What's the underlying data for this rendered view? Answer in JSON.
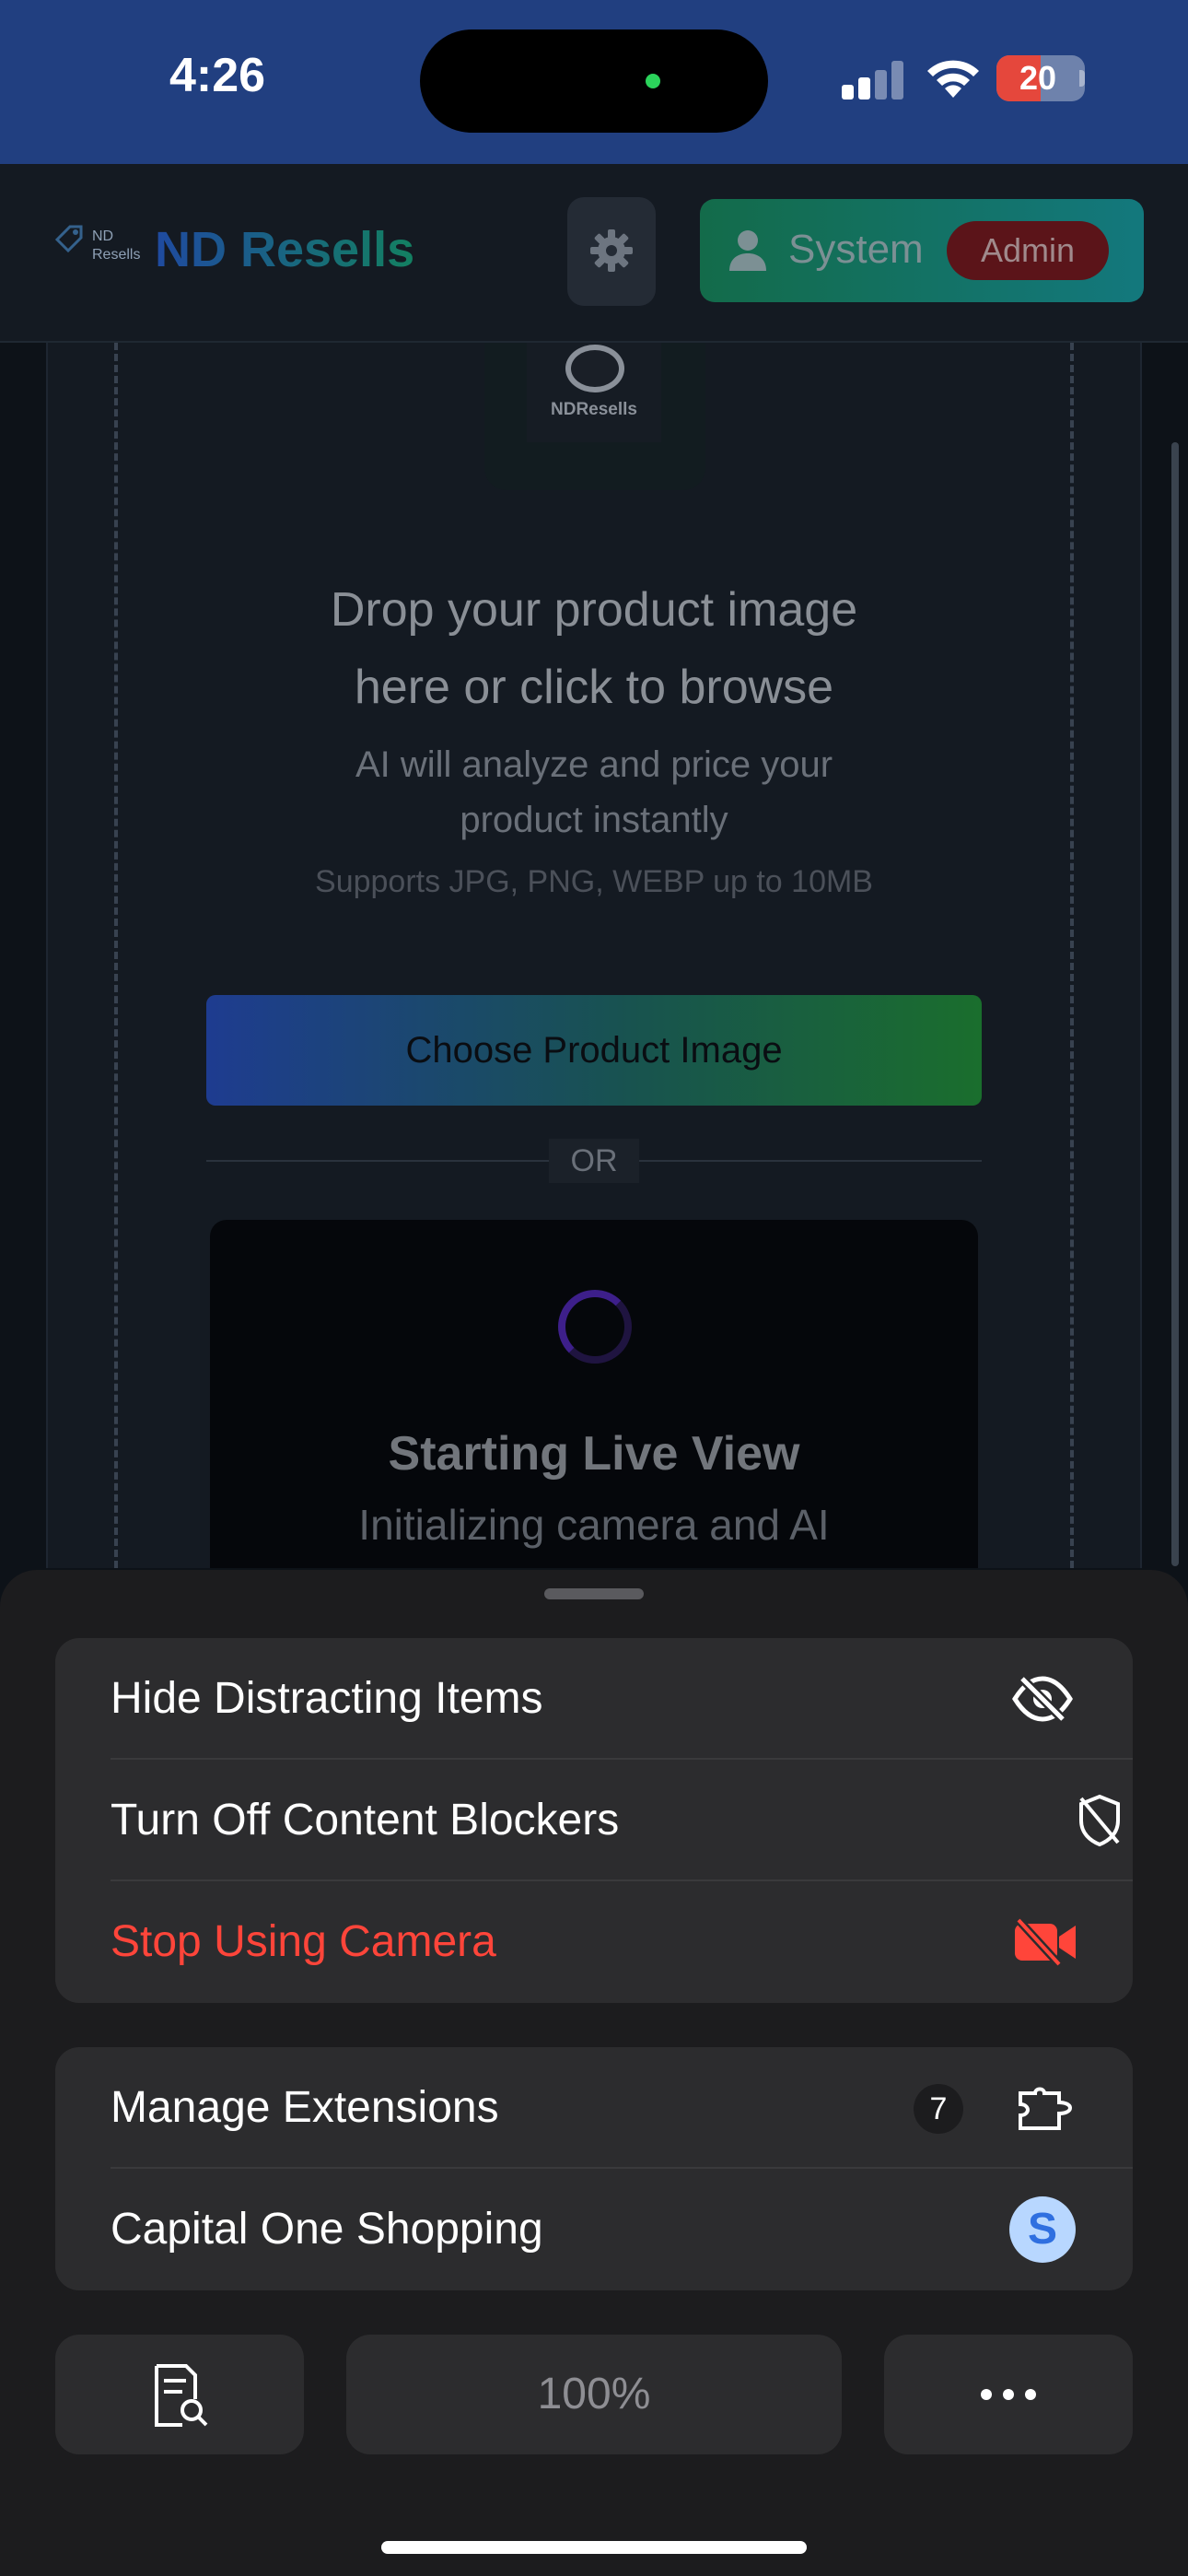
{
  "status_bar": {
    "time": "4:26",
    "battery": "20",
    "battery_color": "#e5473c"
  },
  "header": {
    "logo_text_line1": "ND",
    "logo_text_line2": "Resells",
    "brand": "ND Resells",
    "settings_icon": "gear-icon",
    "user_name": "System",
    "user_role": "Admin"
  },
  "upload": {
    "camera_label": "NDResells",
    "title_line1": "Drop your product image",
    "title_line2": "here or click to browse",
    "subtitle_line1": "AI will analyze and price your",
    "subtitle_line2": "product instantly",
    "formats": "Supports JPG, PNG, WEBP up to 10MB",
    "choose_button": "Choose Product Image",
    "or_text": "OR",
    "live_title": "Starting Live View",
    "live_subtitle": "Initializing camera and AI"
  },
  "menu": {
    "group1": [
      {
        "label": "Hide Distracting Items",
        "icon": "eye-slash-icon"
      },
      {
        "label": "Turn Off Content Blockers",
        "icon": "shield-slash-icon"
      },
      {
        "label": "Stop Using Camera",
        "icon": "video-slash-icon",
        "color": "#ff453a"
      }
    ],
    "group2": [
      {
        "label": "Manage Extensions",
        "icon": "puzzle-icon",
        "badge": "7"
      },
      {
        "label": "Capital One Shopping",
        "icon": "capital-one-shopping-icon",
        "icon_letter": "S"
      }
    ],
    "bottom": {
      "left_icon": "page-search-icon",
      "zoom": "100%",
      "right_icon": "more-icon"
    }
  }
}
